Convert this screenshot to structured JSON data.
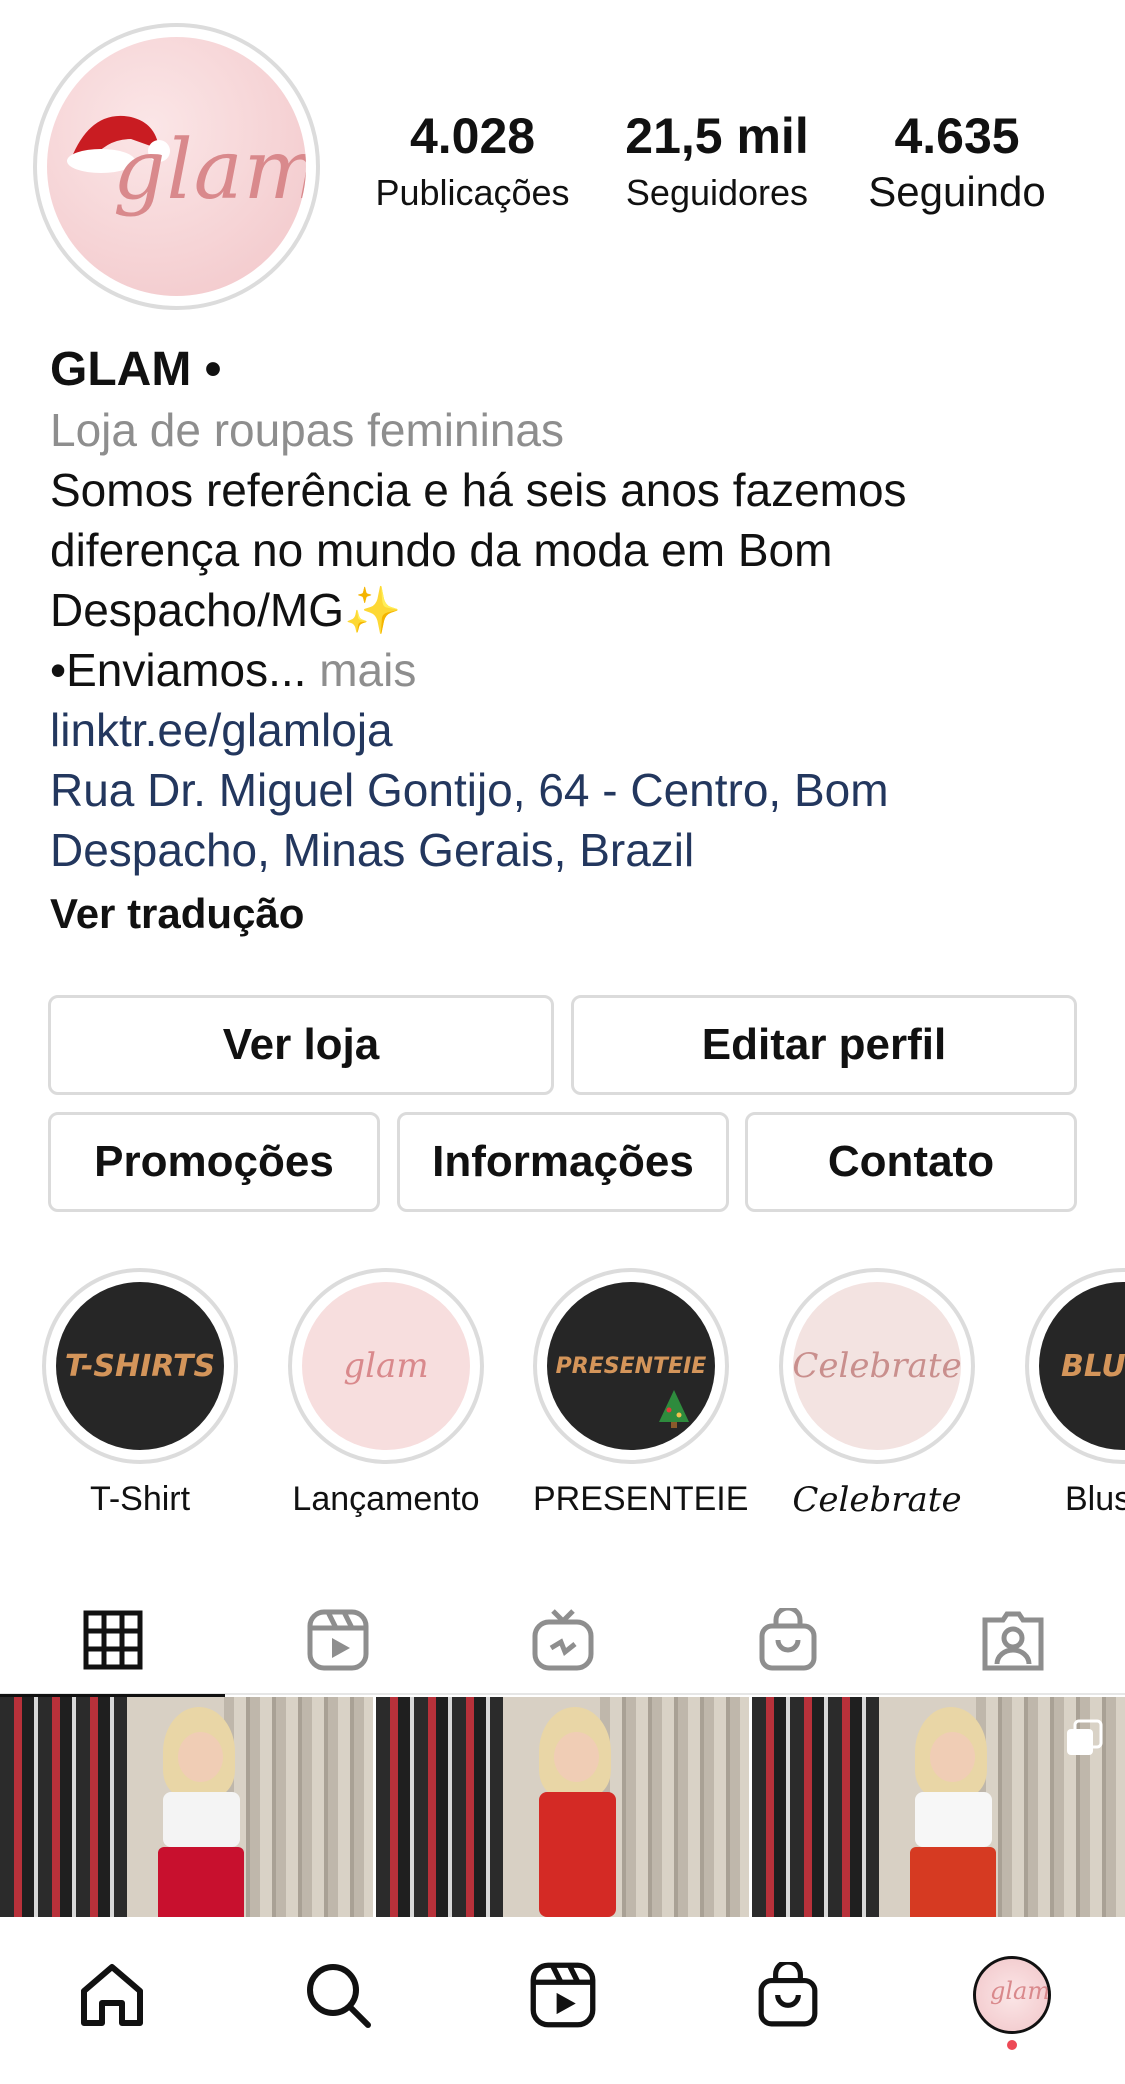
{
  "profile": {
    "avatar_text": "glam",
    "stats": [
      {
        "value": "4.028",
        "label": "Publicações"
      },
      {
        "value": "21,5 mil",
        "label": "Seguidores"
      },
      {
        "value": "4.635",
        "label": "Seguindo"
      }
    ]
  },
  "bio": {
    "name": "GLAM •",
    "category": "Loja de roupas femininas",
    "line1": "Somos referência e há seis anos fazemos",
    "line2": "diferença no mundo da moda em Bom",
    "line3": "Despacho/MG✨",
    "line4": "•Enviamos...",
    "more": " mais",
    "link": "linktr.ee/glamloja",
    "address_line1": "Rua Dr. Miguel Gontijo, 64 - Centro, Bom",
    "address_line2": "Despacho, Minas Gerais, Brazil",
    "translate": "Ver tradução"
  },
  "buttons": {
    "shop": "Ver loja",
    "edit_profile": "Editar perfil",
    "promotions": "Promoções",
    "info": "Informações",
    "contact": "Contato"
  },
  "highlights": [
    {
      "label": "T-Shirt",
      "cover_text": "T-SHIRTS"
    },
    {
      "label": "Lançamento",
      "cover_text": "glam"
    },
    {
      "label": "PRESENTEIE",
      "cover_text": "PRESENTEIE"
    },
    {
      "label": "Celebrate",
      "cover_text": "Celebrate"
    },
    {
      "label": "Blus",
      "cover_text": "BLUS"
    }
  ],
  "tabs": [
    "grid",
    "reels",
    "igtv",
    "shop",
    "tagged"
  ],
  "posts": [
    {
      "top_color": "#f4f4f4",
      "bottom_color": "#c8102e"
    },
    {
      "top_color": "#d42a25",
      "bottom_color": "#d42a25"
    },
    {
      "top_color": "#f7f7f7",
      "bottom_color": "#d63a22"
    }
  ],
  "bottom_nav": [
    "home",
    "search",
    "reels",
    "shop",
    "profile"
  ],
  "colors": {
    "link": "#23375e",
    "muted": "#8e8e8e",
    "notification_dot": "#ed4956",
    "highlight_gold": "#d4955a"
  }
}
